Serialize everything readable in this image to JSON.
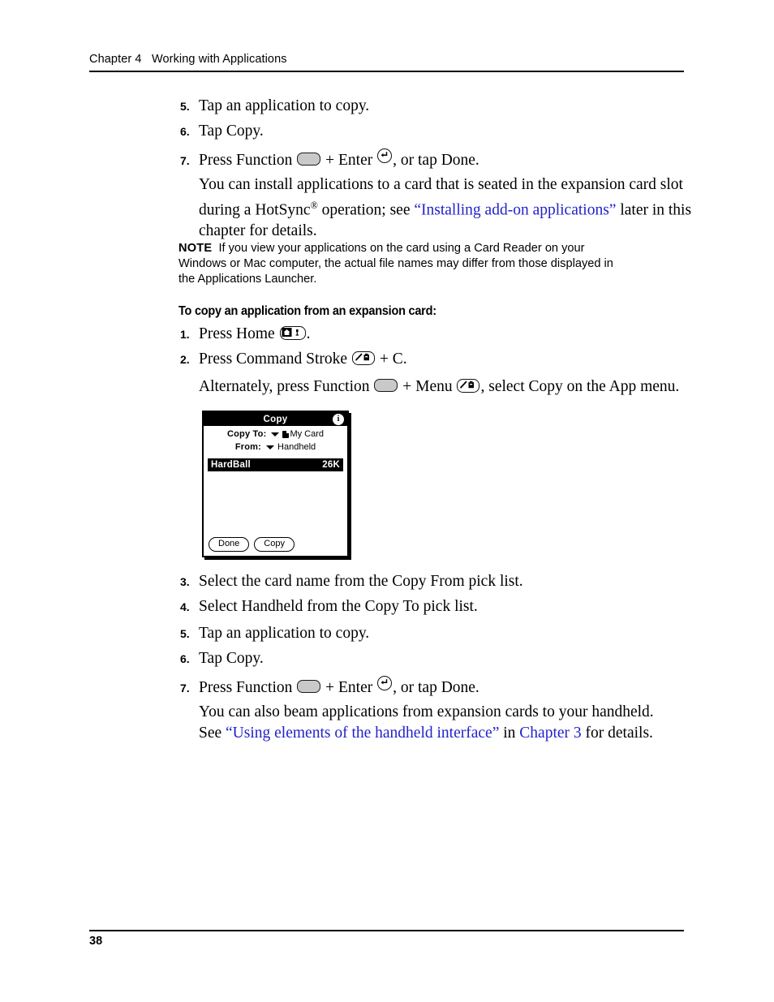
{
  "header": {
    "text": "Chapter 4   Working with Applications"
  },
  "steps_first_group": [
    {
      "num": "5.",
      "text": "Tap an application to copy."
    },
    {
      "num": "6.",
      "text": "Tap Copy."
    }
  ],
  "step7_a": {
    "num": "7.",
    "before_function": "Press Function",
    "plus_enter": "+ Enter",
    "after_enter": ", or tap Done."
  },
  "paragraph_install": {
    "line1": "You can install applications to a card that is seated in the expansion card slot",
    "line2_a": "during a HotSync",
    "line2_sup": "®",
    "line2_b": " operation; see ",
    "line2_link": "“Installing add-on applications”",
    "line2_c": " later in this",
    "line3": "chapter for details."
  },
  "note": {
    "label": "NOTE",
    "line1": "If you view your applications on the card using a Card Reader on your",
    "line2": "Windows or Mac computer, the actual file names may differ from those displayed in",
    "line3": "the Applications Launcher."
  },
  "section_heading": "To copy an application from an expansion card:",
  "steps_second_group": {
    "step1": {
      "num": "1.",
      "before_icon": "Press Home",
      "after_icon": "."
    },
    "step2": {
      "num": "2.",
      "before_icon": "Press Command Stroke",
      "after_icon": "+ C."
    },
    "alternately": {
      "before_function": "Alternately, press Function",
      "plus_menu": "+ Menu",
      "after_menu": ", select Copy on the App menu."
    },
    "step3": {
      "num": "3.",
      "text": "Select the card name from the Copy From pick list."
    },
    "step4": {
      "num": "4.",
      "text": "Select Handheld from the Copy To pick list."
    },
    "step5": {
      "num": "5.",
      "text": "Tap an application to copy."
    },
    "step6": {
      "num": "6.",
      "text": "Tap Copy."
    },
    "step7": {
      "num": "7.",
      "before_function": "Press Function",
      "plus_enter": "+ Enter",
      "after_enter": ", or tap Done."
    }
  },
  "paragraph_beam": {
    "line1": "You can also beam applications from expansion cards to your handheld.",
    "line2_a": "See ",
    "line2_link1": "“Using elements of the handheld interface”",
    "line2_b": " in ",
    "line2_link2": "Chapter 3",
    "line2_c": " for details."
  },
  "palm_dialog": {
    "title": "Copy",
    "info_icon_label": "i",
    "copy_to_label": "Copy To:",
    "copy_to_value": "My Card",
    "from_label": "From:",
    "from_value": "Handheld",
    "list_item_name": "HardBall",
    "list_item_size": "26K",
    "button_done": "Done",
    "button_copy": "Copy"
  },
  "footer": {
    "page_number": "38"
  },
  "colors": {
    "link": "#2222cc",
    "text": "#000000",
    "function_key_fill": "#c9c9c9"
  }
}
